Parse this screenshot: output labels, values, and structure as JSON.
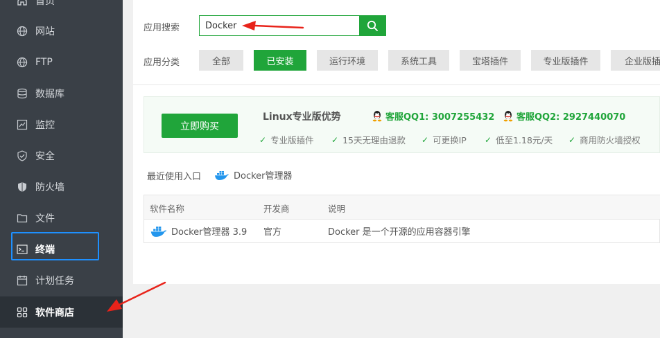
{
  "sidebar": {
    "items": [
      {
        "label": "首页",
        "icon": "home-icon"
      },
      {
        "label": "网站",
        "icon": "globe-icon"
      },
      {
        "label": "FTP",
        "icon": "ftp-globe-icon"
      },
      {
        "label": "数据库",
        "icon": "database-icon"
      },
      {
        "label": "监控",
        "icon": "monitor-icon"
      },
      {
        "label": "安全",
        "icon": "shield-check-icon"
      },
      {
        "label": "防火墙",
        "icon": "firewall-shield-icon"
      },
      {
        "label": "文件",
        "icon": "folder-icon"
      },
      {
        "label": "终端",
        "icon": "terminal-icon"
      },
      {
        "label": "计划任务",
        "icon": "clock-icon"
      },
      {
        "label": "软件商店",
        "icon": "apps-grid-icon"
      }
    ]
  },
  "search": {
    "label": "应用搜索",
    "value": "Docker"
  },
  "category": {
    "label": "应用分类",
    "items": [
      "全部",
      "已安装",
      "运行环境",
      "系统工具",
      "宝塔插件",
      "专业版插件",
      "企业版插件"
    ],
    "active": "已安装"
  },
  "promo": {
    "buy_label": "立即购买",
    "title": "Linux专业版优势",
    "qq1": "客服QQ1: 3007255432",
    "qq2": "客服QQ2: 2927440070",
    "features": [
      "专业版插件",
      "15天无理由退款",
      "可更换IP",
      "低至1.18元/天",
      "商用防火墙授权"
    ]
  },
  "recent": {
    "label": "最近使用入口",
    "link": "Docker管理器"
  },
  "table": {
    "headers": [
      "软件名称",
      "开发商",
      "说明"
    ],
    "rows": [
      {
        "name": "Docker管理器 3.9",
        "vendor": "官方",
        "desc": "Docker 是一个开源的应用容器引擎"
      }
    ]
  },
  "colors": {
    "accent": "#20a53a",
    "sidebar_bg": "#3a4047",
    "annotation_red": "#e8231a",
    "highlight_blue": "#1e90ff"
  }
}
